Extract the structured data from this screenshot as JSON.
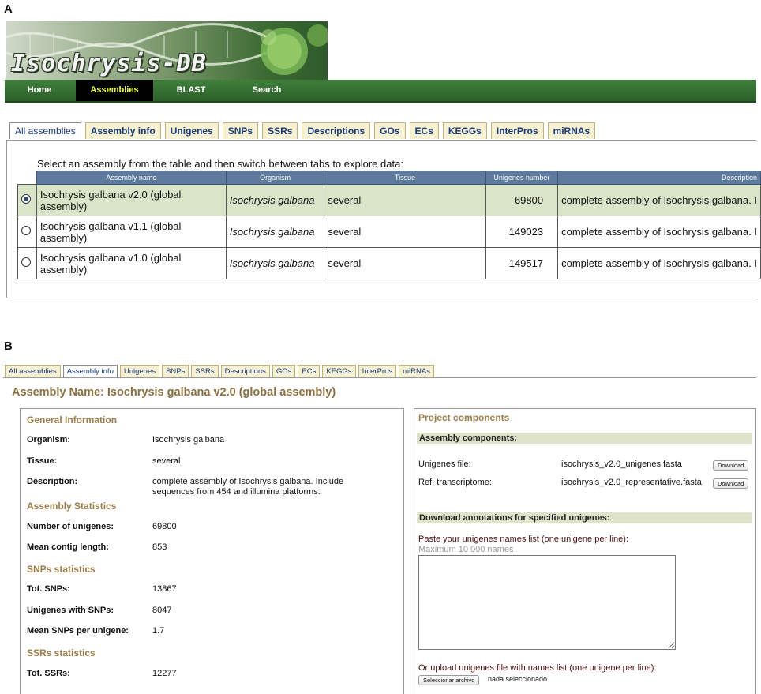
{
  "panel_a_letter": "A",
  "panel_b_letter": "B",
  "banner": {
    "title": "Isochrysis-DB"
  },
  "main_nav": [
    {
      "label": "Home",
      "active": false
    },
    {
      "label": "Assemblies",
      "active": true
    },
    {
      "label": "BLAST",
      "active": false
    },
    {
      "label": "Search",
      "active": false
    }
  ],
  "tabs": [
    "All assemblies",
    "Assembly info",
    "Unigenes",
    "SNPs",
    "SSRs",
    "Descriptions",
    "GOs",
    "ECs",
    "KEGGs",
    "InterPros",
    "miRNAs"
  ],
  "panel_a": {
    "active_tab": "All assemblies",
    "instruction": "Select an assembly from the table and then switch between tabs to explore data:",
    "columns": [
      "Assembly name",
      "Organism",
      "Tissue",
      "Unigenes number",
      "Description"
    ],
    "rows": [
      {
        "selected": true,
        "name": "Isochrysis galbana v2.0 (global assembly)",
        "organism": "Isochrysis galbana",
        "tissue": "several",
        "unigenes": "69800",
        "description": "complete assembly of Isochrysis galbana. I"
      },
      {
        "selected": false,
        "name": "Isochrysis galbana v1.1 (global assembly)",
        "organism": "Isochrysis galbana",
        "tissue": "several",
        "unigenes": "149023",
        "description": "complete assembly of Isochrysis galbana. I"
      },
      {
        "selected": false,
        "name": "Isochrysis galbana v1.0 (global assembly)",
        "organism": "Isochrysis galbana",
        "tissue": "several",
        "unigenes": "149517",
        "description": "complete assembly of Isochrysis galbana. I"
      }
    ]
  },
  "panel_b": {
    "active_tab": "Assembly info",
    "assembly_name": "Assembly Name: Isochrysis galbana v2.0 (global assembly)",
    "general": {
      "heading": "General Information",
      "organism_label": "Organism:",
      "organism": "Isochrysis galbana",
      "tissue_label": "Tissue:",
      "tissue": "several",
      "description_label": "Description:",
      "description_line1": "complete assembly of Isochrysis galbana. Include",
      "description_line2": "sequences from 454 and illumina platforms."
    },
    "assembly_stats": {
      "heading": "Assembly Statistics",
      "unigenes_label": "Number of unigenes:",
      "unigenes": "69800",
      "contig_label": "Mean contig length:",
      "contig": "853"
    },
    "snp_stats": {
      "heading": "SNPs statistics",
      "tot_label": "Tot. SNPs:",
      "tot": "13867",
      "with_label": "Unigenes with SNPs:",
      "with": "8047",
      "mean_label": "Mean SNPs per unigene:",
      "mean": "1.7"
    },
    "ssr_stats": {
      "heading": "SSRs statistics",
      "tot_label": "Tot. SSRs:",
      "tot": "12277"
    },
    "project": {
      "heading": "Project components",
      "assembly_components": "Assembly components:",
      "unigenes_file_label": "Unigenes file:",
      "unigenes_file": "isochrysis_v2.0_unigenes.fasta",
      "ref_label": "Ref. transcriptome:",
      "ref_file": "isochrysis_v2.0_representative.fasta",
      "download": "Download",
      "download_annotations": "Download annotations for specified unigenes:",
      "paste_label": "Paste your unigenes names list (one unigene per line):",
      "max_note": "Maximum 10 000 names",
      "upload_label": "Or upload unigenes file with names list (one unigene per line):",
      "choose_file": "Seleccionar archivo",
      "no_file": "nada seleccionado"
    }
  },
  "colors": {
    "nav_green": "#2c6129",
    "active_nav_text": "#e8ff40",
    "section_brown": "#9b7f4a",
    "header_blue": "#5d7a9d",
    "selected_row": "#d9e4c8"
  }
}
